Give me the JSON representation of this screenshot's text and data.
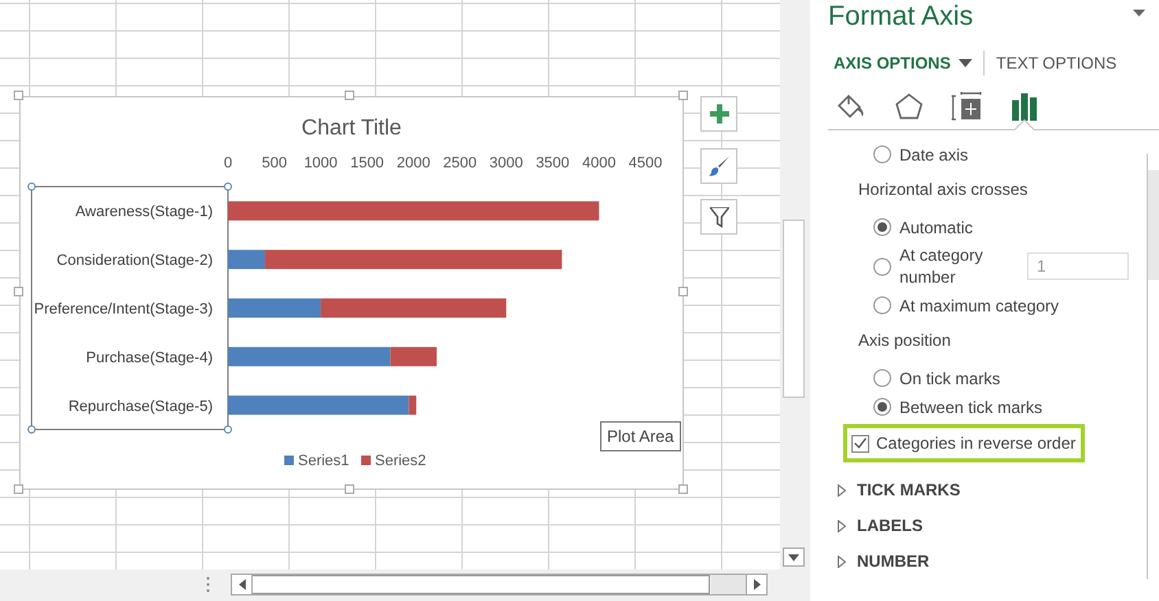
{
  "spreadsheet": {
    "chart": {
      "tooltip": "Plot Area",
      "axis_selected": true,
      "chart_data": {
        "type": "bar",
        "orientation": "horizontal",
        "stacked": true,
        "title": "Chart Title",
        "categories": [
          "Awareness(Stage-1)",
          "Consideration(Stage-2)",
          "Preference/Intent(Stage-3)",
          "Purchase(Stage-4)",
          "Repurchase(Stage-5)"
        ],
        "series": [
          {
            "name": "Series1",
            "color": "#4f81bd",
            "values": [
              0,
              400,
              1000,
              1750,
              1950
            ]
          },
          {
            "name": "Series2",
            "color": "#c0504d",
            "values": [
              4000,
              3200,
              2000,
              500,
              80
            ]
          }
        ],
        "legend": "bottom",
        "xlim": [
          0,
          4500
        ],
        "xticks": [
          0,
          500,
          1000,
          1500,
          2000,
          2500,
          3000,
          3500,
          4000,
          4500
        ]
      }
    }
  },
  "format_pane": {
    "title": "Format Axis",
    "tabs": [
      {
        "label": "AXIS OPTIONS",
        "selected": true
      },
      {
        "label": "TEXT OPTIONS",
        "selected": false
      }
    ],
    "icon_tabs": [
      {
        "selected": false
      },
      {
        "selected": false
      },
      {
        "selected": false
      },
      {
        "selected": true
      }
    ],
    "options": [
      {
        "kind": "radio",
        "label": "Date axis",
        "selected": false
      },
      {
        "kind": "heading",
        "label": "Horizontal axis crosses"
      },
      {
        "kind": "radio",
        "label": "Automatic",
        "selected": true
      },
      {
        "kind": "radio",
        "label": "At category number",
        "selected": false,
        "value": "1"
      },
      {
        "kind": "radio",
        "label": "At maximum category",
        "selected": false
      },
      {
        "kind": "heading",
        "label": "Axis position"
      },
      {
        "kind": "radio",
        "label": "On tick marks",
        "selected": false
      },
      {
        "kind": "radio",
        "label": "Between tick marks",
        "selected": true
      },
      {
        "kind": "checkbox",
        "label": "Categories in reverse order",
        "checked": true,
        "highlighted": true
      }
    ],
    "sections": [
      {
        "label": "TICK MARKS",
        "expanded": false
      },
      {
        "label": "LABELS",
        "expanded": false
      },
      {
        "label": "NUMBER",
        "expanded": false
      }
    ]
  }
}
